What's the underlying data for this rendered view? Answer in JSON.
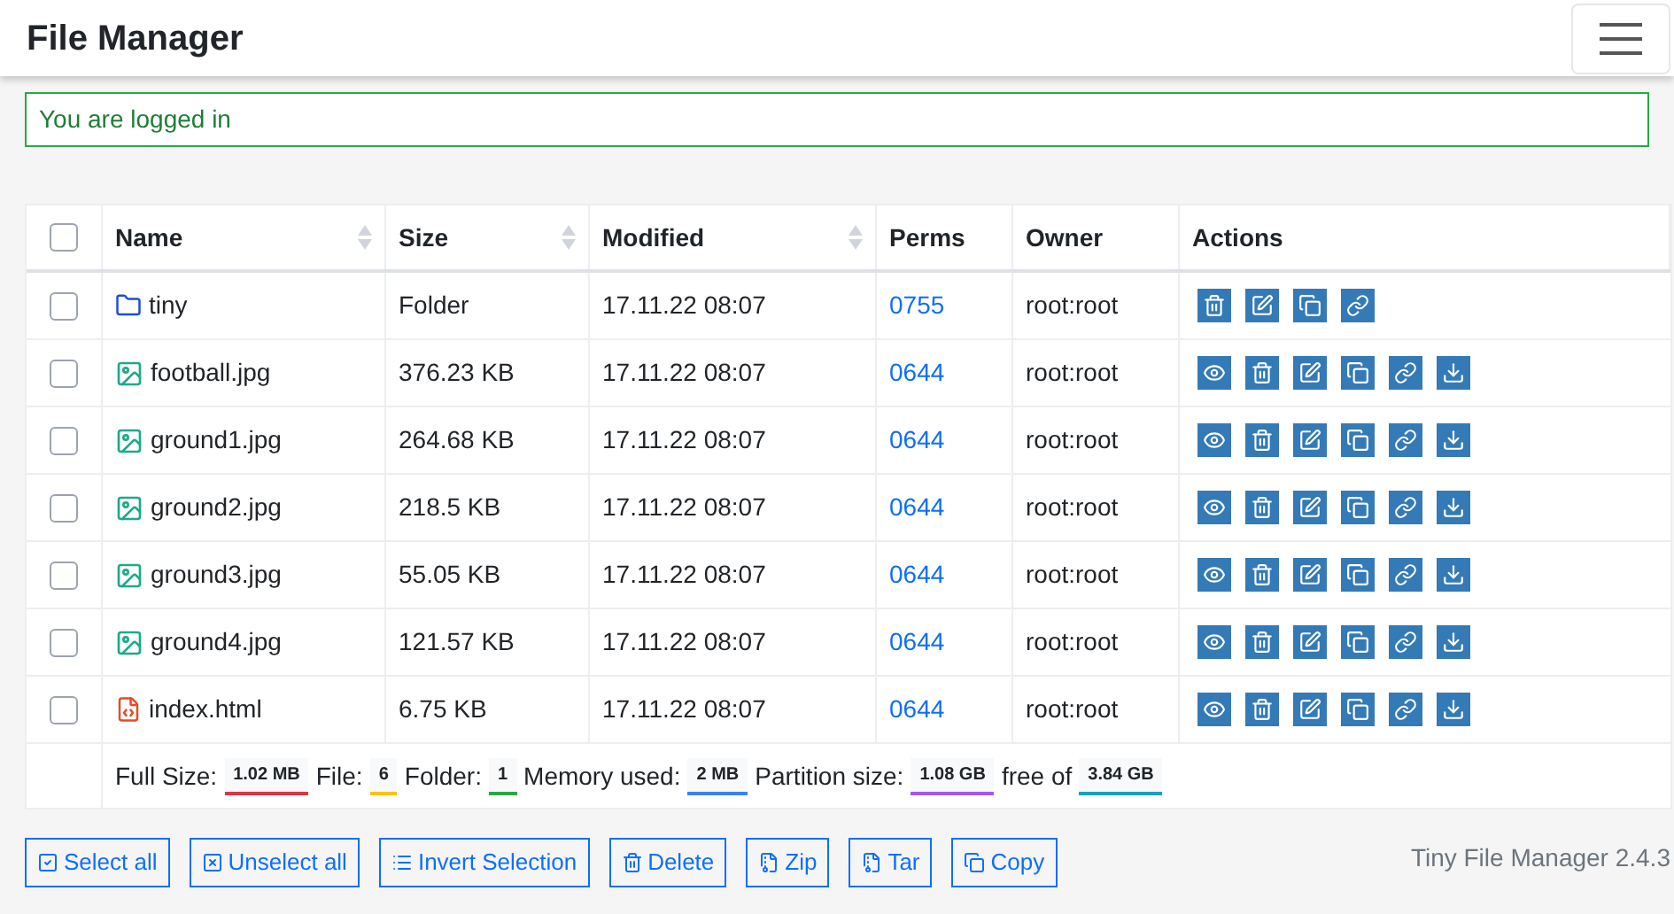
{
  "header": {
    "title": "File Manager"
  },
  "alert": {
    "text": "You are logged in"
  },
  "table": {
    "all_checked": false,
    "columns": [
      {
        "label": "Name",
        "sortable": true
      },
      {
        "label": "Size",
        "sortable": true
      },
      {
        "label": "Modified",
        "sortable": true
      },
      {
        "label": "Perms",
        "sortable": false
      },
      {
        "label": "Owner",
        "sortable": false
      },
      {
        "label": "Actions",
        "sortable": false
      }
    ],
    "rows": [
      {
        "checked": false,
        "kind": "folder",
        "name": "tiny",
        "size": "Folder",
        "modified": "17.11.22 08:07",
        "perms": "0755",
        "owner": "root:root",
        "actions": [
          {
            "kind": "delete"
          },
          {
            "kind": "edit"
          },
          {
            "kind": "copy"
          },
          {
            "kind": "link"
          }
        ]
      },
      {
        "checked": false,
        "kind": "image",
        "name": "football.jpg",
        "size": "376.23 KB",
        "modified": "17.11.22 08:07",
        "perms": "0644",
        "owner": "root:root",
        "actions": [
          {
            "kind": "view"
          },
          {
            "kind": "delete"
          },
          {
            "kind": "edit"
          },
          {
            "kind": "copy"
          },
          {
            "kind": "link"
          },
          {
            "kind": "download"
          }
        ]
      },
      {
        "checked": false,
        "kind": "image",
        "name": "ground1.jpg",
        "size": "264.68 KB",
        "modified": "17.11.22 08:07",
        "perms": "0644",
        "owner": "root:root",
        "actions": [
          {
            "kind": "view"
          },
          {
            "kind": "delete"
          },
          {
            "kind": "edit"
          },
          {
            "kind": "copy"
          },
          {
            "kind": "link"
          },
          {
            "kind": "download"
          }
        ]
      },
      {
        "checked": false,
        "kind": "image",
        "name": "ground2.jpg",
        "size": "218.5 KB",
        "modified": "17.11.22 08:07",
        "perms": "0644",
        "owner": "root:root",
        "actions": [
          {
            "kind": "view"
          },
          {
            "kind": "delete"
          },
          {
            "kind": "edit"
          },
          {
            "kind": "copy"
          },
          {
            "kind": "link"
          },
          {
            "kind": "download"
          }
        ]
      },
      {
        "checked": false,
        "kind": "image",
        "name": "ground3.jpg",
        "size": "55.05 KB",
        "modified": "17.11.22 08:07",
        "perms": "0644",
        "owner": "root:root",
        "actions": [
          {
            "kind": "view"
          },
          {
            "kind": "delete"
          },
          {
            "kind": "edit"
          },
          {
            "kind": "copy"
          },
          {
            "kind": "link"
          },
          {
            "kind": "download"
          }
        ]
      },
      {
        "checked": false,
        "kind": "image",
        "name": "ground4.jpg",
        "size": "121.57 KB",
        "modified": "17.11.22 08:07",
        "perms": "0644",
        "owner": "root:root",
        "actions": [
          {
            "kind": "view"
          },
          {
            "kind": "delete"
          },
          {
            "kind": "edit"
          },
          {
            "kind": "copy"
          },
          {
            "kind": "link"
          },
          {
            "kind": "download"
          }
        ]
      },
      {
        "checked": false,
        "kind": "html",
        "name": "index.html",
        "size": "6.75 KB",
        "modified": "17.11.22 08:07",
        "perms": "0644",
        "owner": "root:root",
        "actions": [
          {
            "kind": "view"
          },
          {
            "kind": "delete"
          },
          {
            "kind": "edit"
          },
          {
            "kind": "copy"
          },
          {
            "kind": "link"
          },
          {
            "kind": "download"
          }
        ]
      }
    ],
    "summary": [
      {
        "label": "Full Size:",
        "value": "1.02 MB",
        "color": "#dc3545"
      },
      {
        "label": "File:",
        "value": "6",
        "color": "#ffc107"
      },
      {
        "label": "Folder:",
        "value": "1",
        "color": "#28a745"
      },
      {
        "label": "Memory used:",
        "value": "2 MB",
        "color": "#3b82f6"
      },
      {
        "label": "Partition size:",
        "value": "1.08 GB",
        "color": "#a855f7"
      },
      {
        "label": "free of",
        "value": "3.84 GB",
        "color": "#17a2b8"
      }
    ]
  },
  "buttons": [
    {
      "kind": "check",
      "label": "Select all"
    },
    {
      "kind": "uncheck",
      "label": "Unselect all"
    },
    {
      "kind": "list",
      "label": "Invert Selection"
    },
    {
      "kind": "delete",
      "label": "Delete"
    },
    {
      "kind": "archive",
      "label": "Zip"
    },
    {
      "kind": "archive",
      "label": "Tar"
    },
    {
      "kind": "copy",
      "label": "Copy"
    }
  ],
  "version": "Tiny File Manager 2.4.3"
}
